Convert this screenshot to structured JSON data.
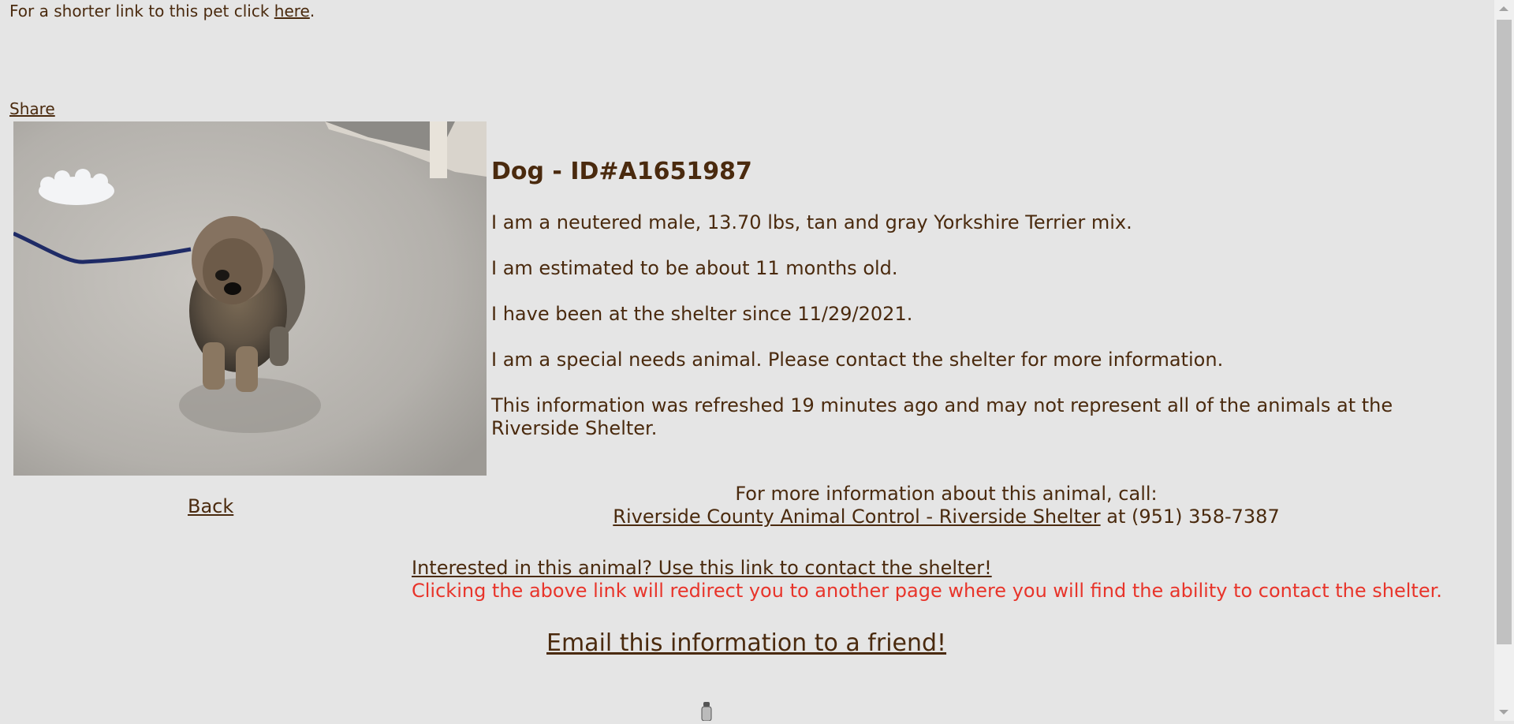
{
  "header": {
    "shortlink_prefix": "For a shorter link to this pet click ",
    "shortlink_link": "here",
    "shortlink_suffix": ".",
    "share_label": "Share"
  },
  "pet": {
    "title": "Dog - ID#A1651987",
    "line1": "I am a neutered male, 13.70 lbs, tan and gray Yorkshire Terrier mix.",
    "line2": "I am estimated to be about 11 months old.",
    "line3": "I have been at the shelter since 11/29/2021.",
    "line4": "I am a special needs animal. Please contact the shelter for more information.",
    "line5": "This information was refreshed 19 minutes ago and may not represent all of the animals at the Riverside Shelter."
  },
  "nav": {
    "back_label": "Back"
  },
  "contact": {
    "intro": "For more information about this animal, call:",
    "shelter_link": "Riverside County Animal Control - Riverside Shelter",
    "phone_text": " at (951) 358-7387",
    "interest_link": "Interested in this animal? Use this link to contact the shelter!",
    "redirect_note": "Clicking the above link will redirect you to another page where you will find the ability to contact the shelter.",
    "email_link": "Email this information to a friend!"
  },
  "colors": {
    "background": "#e5e5e5",
    "text": "#4a2a0e",
    "warning": "#e8342a"
  }
}
